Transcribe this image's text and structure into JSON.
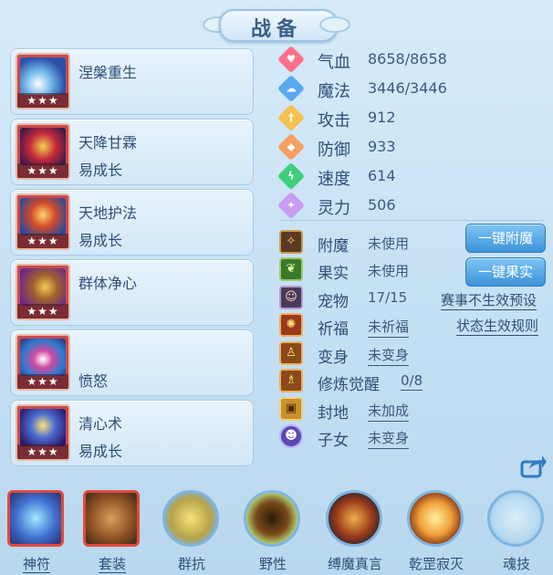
{
  "title": "战备",
  "skills": [
    {
      "name": "涅槃重生",
      "sub": "",
      "stars": "★★★",
      "icon": "fan-icon"
    },
    {
      "name": "天降甘霖",
      "sub": "易成长",
      "stars": "★★★",
      "icon": "dragon-mask-icon"
    },
    {
      "name": "天地护法",
      "sub": "易成长",
      "stars": "★★★",
      "icon": "guardian-icon"
    },
    {
      "name": "群体净心",
      "sub": "",
      "stars": "★★★",
      "icon": "serpent-icon"
    },
    {
      "name": "",
      "sub": "愤怒",
      "stars": "★★★",
      "icon": "eye-icon"
    },
    {
      "name": "清心术",
      "sub": "易成长",
      "stars": "★★★",
      "icon": "wizard-icon"
    }
  ],
  "stats": [
    {
      "label": "气血",
      "value": "8658/8658",
      "color": "#ff6f8a",
      "icon": "heart-icon"
    },
    {
      "label": "魔法",
      "value": "3446/3446",
      "color": "#59a8f2",
      "icon": "cloud-icon"
    },
    {
      "label": "攻击",
      "value": "912",
      "color": "#f6c14e",
      "icon": "sword-icon"
    },
    {
      "label": "防御",
      "value": "933",
      "color": "#f6a061",
      "icon": "shield-icon"
    },
    {
      "label": "速度",
      "value": "614",
      "color": "#3fcf7a",
      "icon": "lightning-icon"
    },
    {
      "label": "灵力",
      "value": "506",
      "color": "#c99cf0",
      "icon": "spirit-icon"
    }
  ],
  "extras": [
    {
      "label": "附魔",
      "value": "未使用",
      "icon": "enchant-icon"
    },
    {
      "label": "果实",
      "value": "未使用",
      "icon": "fruit-icon"
    },
    {
      "label": "宠物",
      "value": "17/15",
      "icon": "pet-icon"
    },
    {
      "label": "祈福",
      "value": "未祈福",
      "icon": "blessing-icon"
    },
    {
      "label": "变身",
      "value": "未变身",
      "icon": "transform-icon"
    },
    {
      "label": "修炼觉醒",
      "value": "0/8",
      "icon": "cultivation-icon"
    },
    {
      "label": "封地",
      "value": "未加成",
      "icon": "fief-icon"
    },
    {
      "label": "子女",
      "value": "未变身",
      "icon": "child-icon"
    }
  ],
  "buttons": {
    "enchant": "一键附魔",
    "fruit": "一键果实"
  },
  "links": {
    "preset": "赛事不生效预设",
    "rules": "状态生效规则"
  },
  "bottom_bar": [
    {
      "label": "神符",
      "icon": "rune-icon"
    },
    {
      "label": "套装",
      "icon": "armor-set-icon"
    },
    {
      "label": "群抗",
      "icon": "group-resist-icon"
    },
    {
      "label": "野性",
      "icon": "wild-icon"
    },
    {
      "label": "缚魔真言",
      "icon": "binding-spell-icon"
    },
    {
      "label": "乾罡寂灭",
      "icon": "annihilation-icon"
    },
    {
      "label": "魂技",
      "icon": "soul-skill-icon"
    }
  ]
}
